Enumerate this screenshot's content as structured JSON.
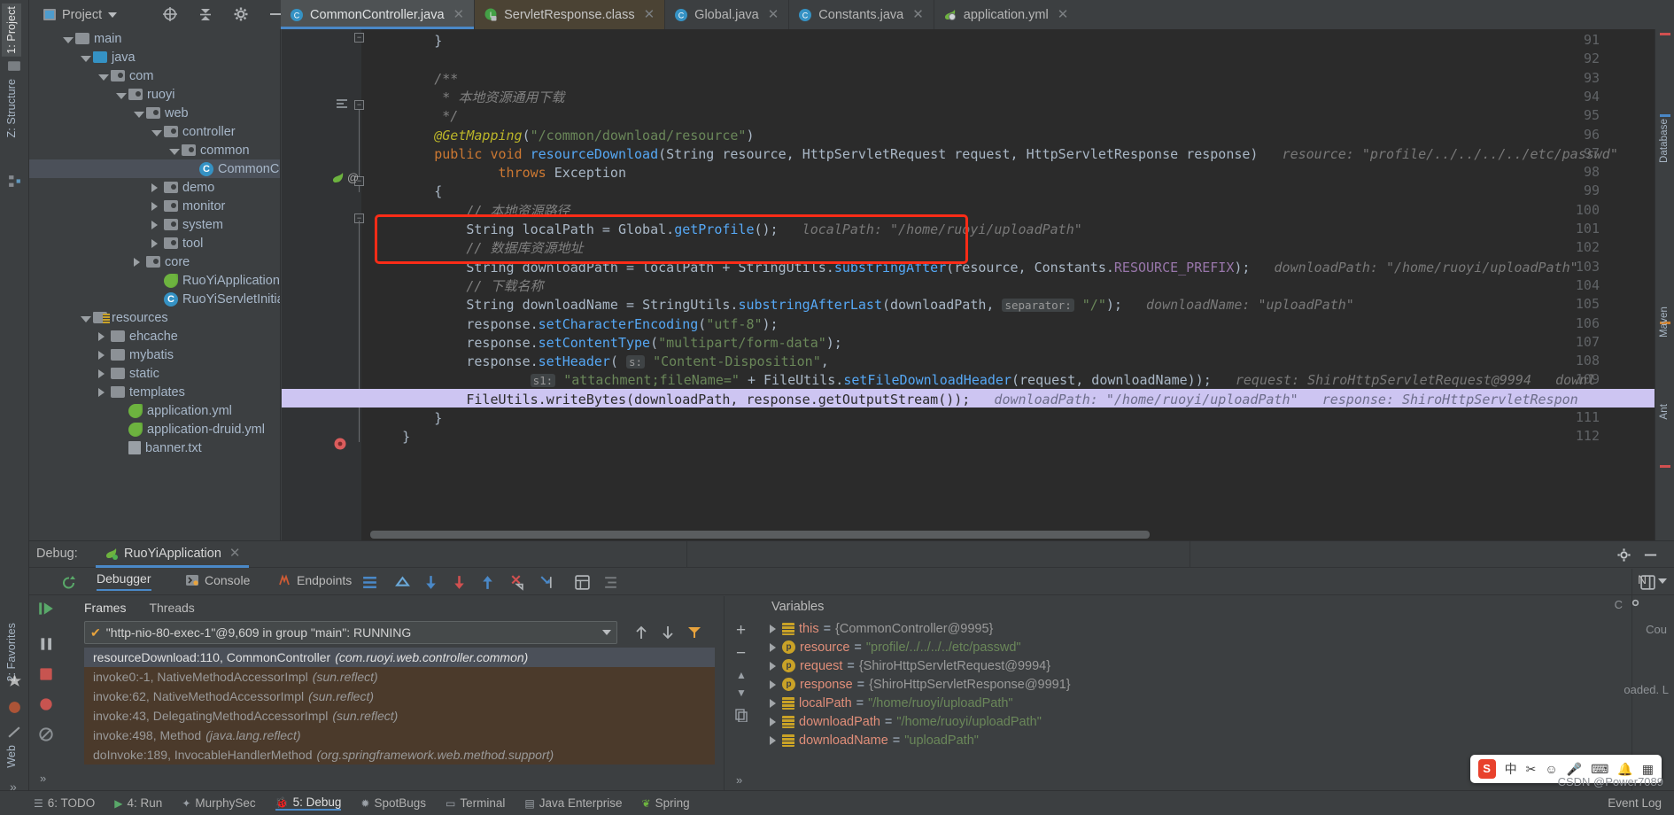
{
  "window": {
    "project_button": "Project",
    "watermark": "CSDN @Power7089"
  },
  "toolbar_icons": [
    "locate-icon",
    "collapse-all-icon",
    "settings-gear-icon",
    "hide-icon"
  ],
  "left_strip": {
    "top_tabs": [
      "1: Project",
      "Z: Structure"
    ],
    "bottom_tabs": [
      "2: Favorites",
      "Web"
    ],
    "right_tabs": [
      "Database",
      "Maven",
      "Ant"
    ]
  },
  "editor_tabs": [
    {
      "label": "CommonController.java",
      "icon": "java-class-icon",
      "active": true,
      "style": "java"
    },
    {
      "label": "ServletResponse.class",
      "icon": "java-interface-locked-icon",
      "active": false,
      "style": "class"
    },
    {
      "label": "Global.java",
      "icon": "java-class-icon",
      "active": false,
      "style": "java"
    },
    {
      "label": "Constants.java",
      "icon": "java-class-icon",
      "active": false,
      "style": "java"
    },
    {
      "label": "application.yml",
      "icon": "spring-yml-icon",
      "active": false,
      "style": "yml"
    }
  ],
  "tree": [
    {
      "label": "main",
      "indent": 3,
      "twisty": "open",
      "icon": "folder-gray"
    },
    {
      "label": "java",
      "indent": 4,
      "twisty": "open",
      "icon": "folder-blue"
    },
    {
      "label": "com",
      "indent": 5,
      "twisty": "open",
      "icon": "folder-pkg"
    },
    {
      "label": "ruoyi",
      "indent": 6,
      "twisty": "open",
      "icon": "folder-pkg"
    },
    {
      "label": "web",
      "indent": 7,
      "twisty": "open",
      "icon": "folder-pkg"
    },
    {
      "label": "controller",
      "indent": 8,
      "twisty": "open",
      "icon": "folder-pkg"
    },
    {
      "label": "common",
      "indent": 9,
      "twisty": "open",
      "icon": "folder-pkg"
    },
    {
      "label": "CommonController",
      "indent": 10,
      "twisty": "none",
      "icon": "java-class-icon",
      "selected": true
    },
    {
      "label": "demo",
      "indent": 8,
      "twisty": "closed",
      "icon": "folder-pkg"
    },
    {
      "label": "monitor",
      "indent": 8,
      "twisty": "closed",
      "icon": "folder-pkg"
    },
    {
      "label": "system",
      "indent": 8,
      "twisty": "closed",
      "icon": "folder-pkg"
    },
    {
      "label": "tool",
      "indent": 8,
      "twisty": "closed",
      "icon": "folder-pkg"
    },
    {
      "label": "core",
      "indent": 7,
      "twisty": "closed",
      "icon": "folder-pkg"
    },
    {
      "label": "RuoYiApplication",
      "indent": 8,
      "twisty": "none",
      "icon": "spring-run-icon"
    },
    {
      "label": "RuoYiServletInitializer",
      "indent": 8,
      "twisty": "none",
      "icon": "java-class-icon"
    },
    {
      "label": "resources",
      "indent": 4,
      "twisty": "open",
      "icon": "folder-resources"
    },
    {
      "label": "ehcache",
      "indent": 5,
      "twisty": "closed",
      "icon": "folder-gray"
    },
    {
      "label": "mybatis",
      "indent": 5,
      "twisty": "closed",
      "icon": "folder-gray"
    },
    {
      "label": "static",
      "indent": 5,
      "twisty": "closed",
      "icon": "folder-gray"
    },
    {
      "label": "templates",
      "indent": 5,
      "twisty": "closed",
      "icon": "folder-gray"
    },
    {
      "label": "application.yml",
      "indent": 6,
      "twisty": "none",
      "icon": "spring-yml-icon"
    },
    {
      "label": "application-druid.yml",
      "indent": 6,
      "twisty": "none",
      "icon": "spring-yml-icon"
    },
    {
      "label": "banner.txt",
      "indent": 6,
      "twisty": "none",
      "icon": "text-file-icon"
    }
  ],
  "editor": {
    "first_line": 91,
    "lines": [
      {
        "n": 91,
        "html": "<span class='id'>        }</span>"
      },
      {
        "n": 92,
        "html": ""
      },
      {
        "n": 93,
        "html": "<span class='cmt'>        /**</span>"
      },
      {
        "n": 94,
        "html": "<span class='cmt'>         * 本地资源通用下载</span>"
      },
      {
        "n": 95,
        "html": "<span class='cmt'>         */</span>"
      },
      {
        "n": 96,
        "html": "<span class='ann'>        @GetMapping</span><span class='id'>(</span><span class='str'>\"/common/download/resource\"</span><span class='id'>)</span>"
      },
      {
        "n": 97,
        "html": "<span class='k'>        public void </span><span class='mth'>resourceDownload</span><span class='id'>(</span><span class='typ'>String </span><span class='id'>resource, </span><span class='typ'>HttpServletRequest </span><span class='id'>request, </span><span class='typ'>HttpServletResponse </span><span class='id'>response)</span><span class='hint'>   resource: \"profile/../../../../etc/passwd\"</span>"
      },
      {
        "n": 98,
        "html": "<span class='k'>                throws </span><span class='typ'>Exception</span>"
      },
      {
        "n": 99,
        "html": "<span class='id'>        {</span>"
      },
      {
        "n": 100,
        "html": "<span class='cmt'>            // 本地资源路径</span>"
      },
      {
        "n": 101,
        "html": "<span class='typ'>            String </span><span class='id'>localPath = </span><span class='typ'>Global</span><span class='id'>.</span><span class='mth'>getProfile</span><span class='id'>();</span><span class='hint'>   localPath: \"/home/ruoyi/uploadPath\"</span>"
      },
      {
        "n": 102,
        "html": "<span class='cmt'>            // 数据库资源地址</span>"
      },
      {
        "n": 103,
        "html": "<span class='typ'>            String </span><span class='id'>downloadPath = localPath + </span><span class='typ'>StringUtils</span><span class='id'>.</span><span class='mth'>substringAfter</span><span class='id'>(resource, </span><span class='typ'>Constants</span><span class='id'>.</span><span class='fld'>RESOURCE_PREFIX</span><span class='id'>);</span><span class='hint'>   downloadPath: \"/home/ruoyi/uploadPath\"</span>"
      },
      {
        "n": 104,
        "html": "<span class='cmt'>            // 下载名称</span>"
      },
      {
        "n": 105,
        "html": "<span class='typ'>            String </span><span class='id'>downloadName = </span><span class='typ'>StringUtils</span><span class='id'>.</span><span class='mth'>substringAfterLast</span><span class='id'>(downloadPath, </span><span class='param-chip'>separator:</span><span class='str'> \"/\"</span><span class='id'>);</span><span class='hint'>   downloadName: \"uploadPath\"</span>"
      },
      {
        "n": 106,
        "html": "<span class='id'>            response.</span><span class='mth'>setCharacterEncoding</span><span class='id'>(</span><span class='str'>\"utf-8\"</span><span class='id'>);</span>"
      },
      {
        "n": 107,
        "html": "<span class='id'>            response.</span><span class='mth'>setContentType</span><span class='id'>(</span><span class='str'>\"multipart/form-data\"</span><span class='id'>);</span>"
      },
      {
        "n": 108,
        "html": "<span class='id'>            response.</span><span class='mth'>setHeader</span><span class='id'>( </span><span class='param-chip'>s:</span><span class='str'> \"Content-Disposition\"</span><span class='id'>,</span>"
      },
      {
        "n": 109,
        "html": "<span class='id'>                    </span><span class='param-chip'>s1:</span><span class='str'> \"attachment;fileName=\"</span><span class='id'> + </span><span class='typ'>FileUtils</span><span class='id'>.</span><span class='mth'>setFileDownloadHeader</span><span class='id'>(request, downloadName));</span><span class='hint'>   request: ShiroHttpServletRequest@9994   downl</span>"
      },
      {
        "n": 110,
        "html": "<span class='typ'>            FileUtils</span><span class='id'>.</span><span class='mth'>writeBytes</span><span class='id'>(downloadPath, response.</span><span class='mth'>getOutputStream</span><span class='id'>());</span><span class='hint'>   downloadPath: \"/home/ruoyi/uploadPath\"   response: ShiroHttpServletRespon</span>",
        "current": true
      },
      {
        "n": 111,
        "html": "<span class='id'>        }</span>"
      },
      {
        "n": 112,
        "html": "<span class='id'>    }</span>"
      }
    ],
    "highlight_box_label": "red-annotation-box",
    "breakpoint_line": 110,
    "current_line": 110
  },
  "debug": {
    "header_label": "Debug:",
    "session_tab": "RuoYiApplication",
    "tabs": [
      {
        "label": "Debugger",
        "icon": "debugger-icon",
        "active": true
      },
      {
        "label": "Console",
        "icon": "console-icon",
        "active": false
      },
      {
        "label": "Endpoints",
        "icon": "endpoints-icon",
        "active": false
      }
    ],
    "step_icons": [
      "layout-icon",
      "step-over-icon",
      "step-into-icon",
      "force-step-into-icon",
      "step-out-icon",
      "drop-frame-icon",
      "run-to-cursor-icon",
      "evaluate-icon",
      "mute-breakpoints-icon"
    ],
    "subtabs": [
      "Frames",
      "Threads"
    ],
    "thread_selector": "\"http-nio-80-exec-1\"@9,609 in group \"main\": RUNNING",
    "frames": [
      {
        "method": "resourceDownload:110, CommonController",
        "pkg": "(com.ruoyi.web.controller.common)",
        "selected": true
      },
      {
        "method": "invoke0:-1, NativeMethodAccessorImpl",
        "pkg": "(sun.reflect)",
        "lib": true
      },
      {
        "method": "invoke:62, NativeMethodAccessorImpl",
        "pkg": "(sun.reflect)",
        "lib": true
      },
      {
        "method": "invoke:43, DelegatingMethodAccessorImpl",
        "pkg": "(sun.reflect)",
        "lib": true
      },
      {
        "method": "invoke:498, Method",
        "pkg": "(java.lang.reflect)",
        "lib": true
      },
      {
        "method": "doInvoke:189, InvocableHandlerMethod",
        "pkg": "(org.springframework.web.method.support)",
        "lib": true
      }
    ],
    "variables_title": "Variables",
    "variables": [
      {
        "name": "this",
        "eq": "=",
        "value": "{CommonController@9995}",
        "kind": "obj",
        "icon": "field-icon"
      },
      {
        "name": "resource",
        "eq": "=",
        "value": "\"profile/../../../../etc/passwd\"",
        "kind": "str",
        "icon": "parameter-icon"
      },
      {
        "name": "request",
        "eq": "=",
        "value": "{ShiroHttpServletRequest@9994}",
        "kind": "obj",
        "icon": "parameter-icon"
      },
      {
        "name": "response",
        "eq": "=",
        "value": "{ShiroHttpServletResponse@9991}",
        "kind": "obj",
        "icon": "parameter-icon"
      },
      {
        "name": "localPath",
        "eq": "=",
        "value": "\"/home/ruoyi/uploadPath\"",
        "kind": "str",
        "icon": "field-icon"
      },
      {
        "name": "downloadPath",
        "eq": "=",
        "value": "\"/home/ruoyi/uploadPath\"",
        "kind": "str",
        "icon": "field-icon"
      },
      {
        "name": "downloadName",
        "eq": "=",
        "value": "\"uploadPath\"",
        "kind": "str",
        "icon": "field-icon"
      }
    ],
    "right_panel": {
      "title": "N",
      "labels": [
        "C",
        "Cou",
        "oaded. L"
      ]
    }
  },
  "statusbar": {
    "items": [
      {
        "label": "6: TODO",
        "icon": "todo-icon"
      },
      {
        "label": "4: Run",
        "icon": "run-icon"
      },
      {
        "label": "MurphySec",
        "icon": "murphysec-icon"
      },
      {
        "label": "5: Debug",
        "icon": "debug-icon",
        "active": true
      },
      {
        "label": "SpotBugs",
        "icon": "spotbugs-icon"
      },
      {
        "label": "Terminal",
        "icon": "terminal-icon"
      },
      {
        "label": "Java Enterprise",
        "icon": "java-enterprise-icon"
      },
      {
        "label": "Spring",
        "icon": "spring-icon"
      }
    ],
    "event_log": "Event Log"
  },
  "ime_widget": {
    "logo": "S",
    "items": [
      "中",
      "✂",
      "☺",
      "🎤",
      "⌨",
      "🔔",
      "▦"
    ]
  }
}
